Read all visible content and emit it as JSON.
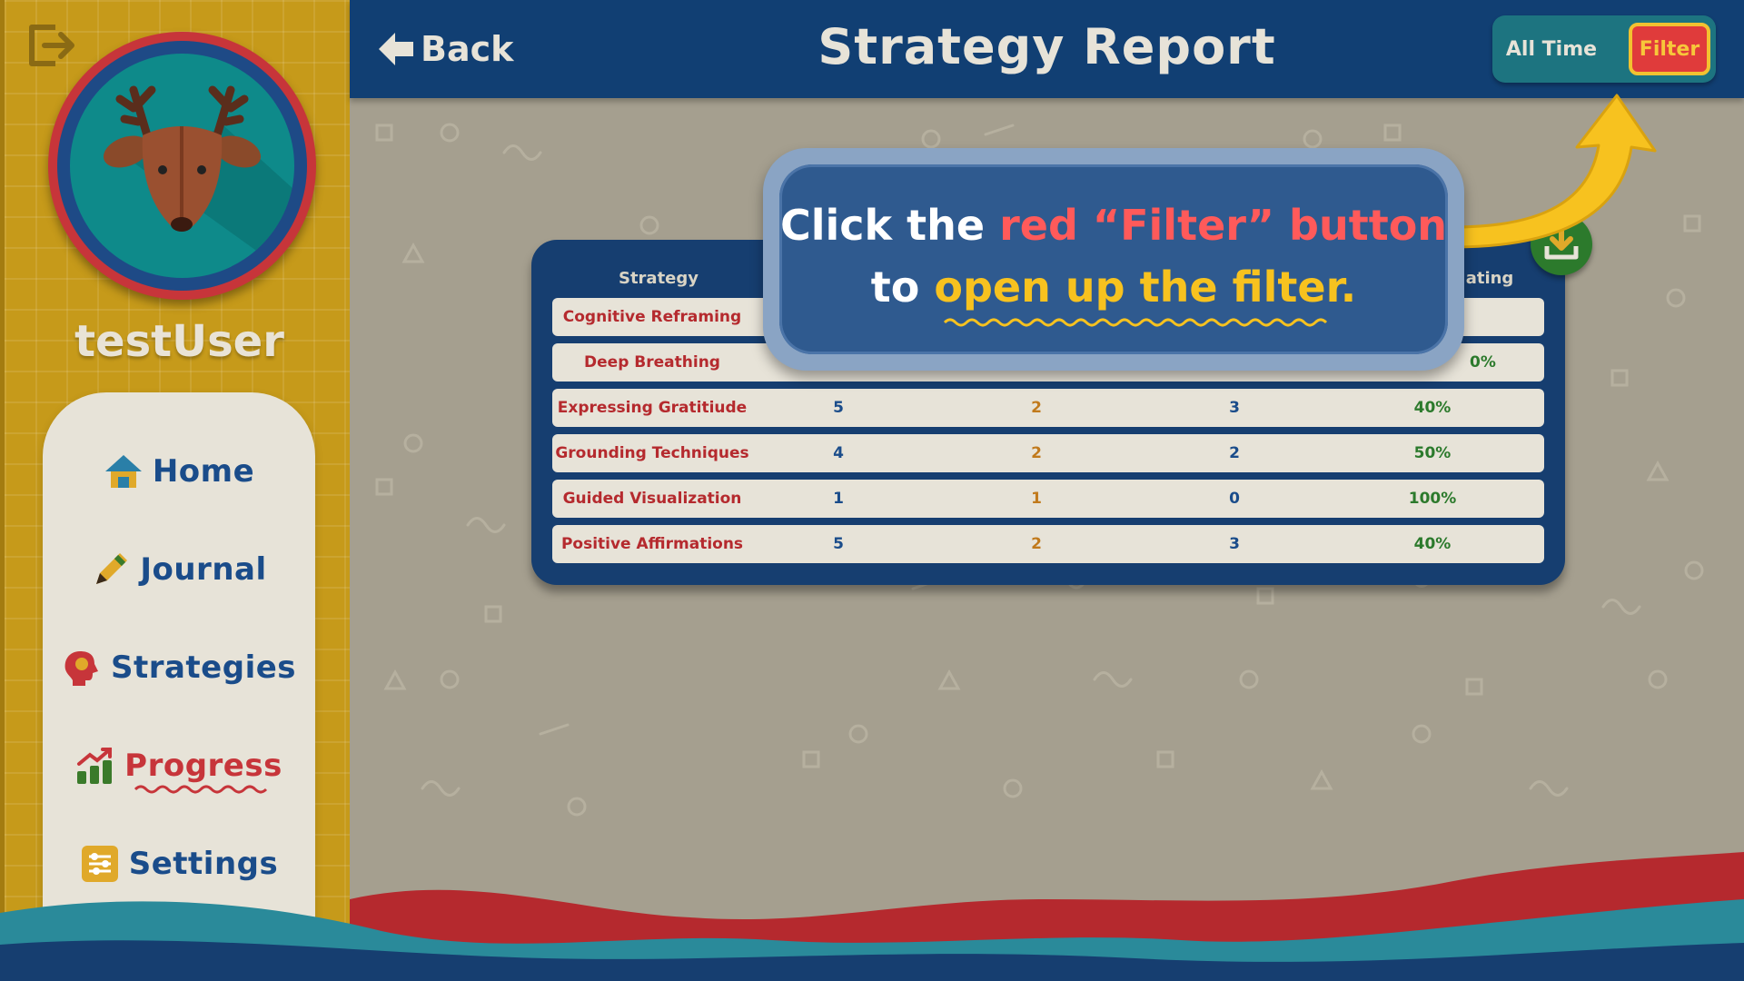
{
  "user": {
    "name": "testUser"
  },
  "nav": [
    {
      "id": "home",
      "label": "Home",
      "icon": "house-icon",
      "active": false
    },
    {
      "id": "journal",
      "label": "Journal",
      "icon": "pencil-icon",
      "active": false
    },
    {
      "id": "strategies",
      "label": "Strategies",
      "icon": "head-icon",
      "active": false
    },
    {
      "id": "progress",
      "label": "Progress",
      "icon": "chart-up-icon",
      "active": true
    },
    {
      "id": "settings",
      "label": "Settings",
      "icon": "sliders-icon",
      "active": false
    }
  ],
  "header": {
    "back_label": "Back",
    "title": "Strategy Report",
    "range_label": "All Time",
    "filter_label": "Filter"
  },
  "table": {
    "columns": [
      "Strategy",
      "ating"
    ],
    "rows": [
      {
        "strategy": "Cognitive Reframing",
        "total": "",
        "helped": "",
        "not_helped": "",
        "rating": ""
      },
      {
        "strategy": "Deep Breathing",
        "total": "",
        "helped": "",
        "not_helped": "",
        "rating": "0%"
      },
      {
        "strategy": "Expressing Gratitiude",
        "total": "5",
        "helped": "2",
        "not_helped": "3",
        "rating": "40%"
      },
      {
        "strategy": "Grounding Techniques",
        "total": "4",
        "helped": "2",
        "not_helped": "2",
        "rating": "50%"
      },
      {
        "strategy": "Guided Visualization",
        "total": "1",
        "helped": "1",
        "not_helped": "0",
        "rating": "100%"
      },
      {
        "strategy": "Positive Affirmations",
        "total": "5",
        "helped": "2",
        "not_helped": "3",
        "rating": "40%"
      }
    ]
  },
  "tutorial": {
    "line1_prefix": "Click the ",
    "line1_highlight": "red “Filter” button",
    "line2_prefix": "to ",
    "line2_highlight": "open up the filter."
  },
  "colors": {
    "header": "#113f73",
    "sidebar": "#c69a1a",
    "accent_red": "#e03b3b",
    "accent_yellow": "#f7c21f",
    "nav_blue": "#1a4c8a"
  }
}
